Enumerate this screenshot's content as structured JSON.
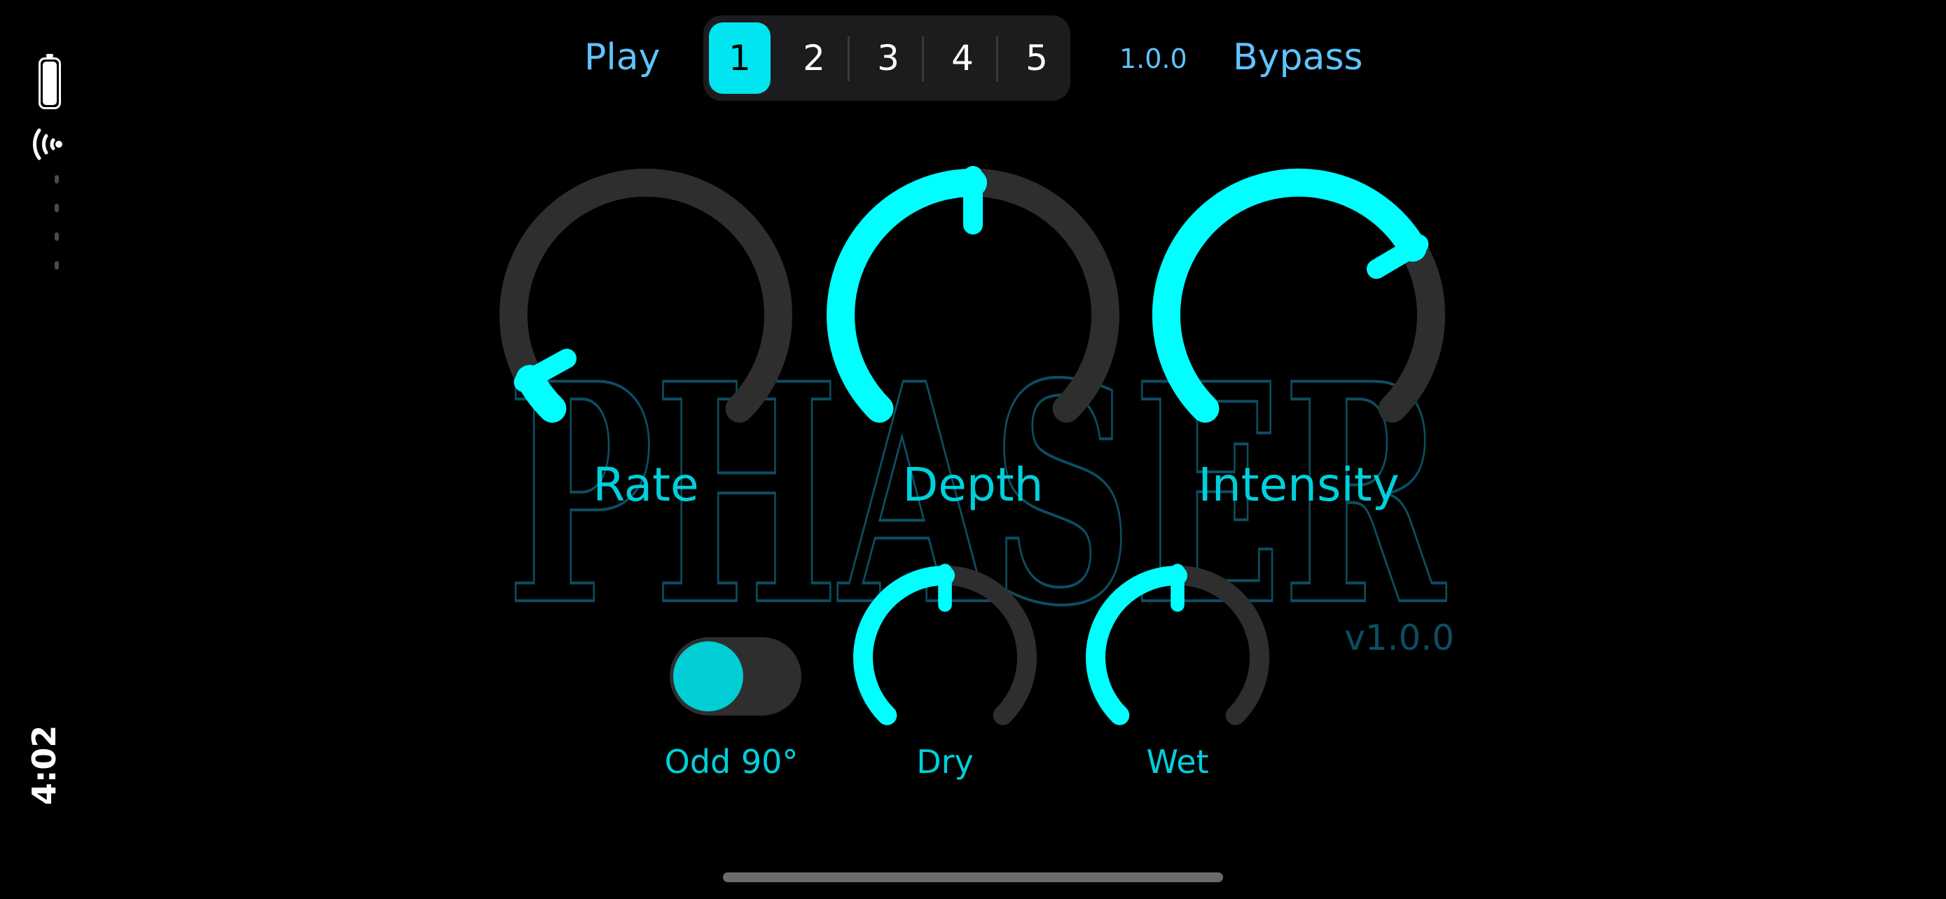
{
  "status_bar": {
    "time": "4:02"
  },
  "toolbar": {
    "play_label": "Play",
    "presets": [
      "1",
      "2",
      "3",
      "4",
      "5"
    ],
    "active_preset": "1",
    "version": "1.0.0",
    "bypass_label": "Bypass"
  },
  "branding": {
    "watermark": "PHASER",
    "version": "v1.0.0"
  },
  "colors": {
    "accent": "#00ffff",
    "track": "#2e2e2e",
    "label": "#00d0dc",
    "toolbar_text": "#5ec4ff",
    "background": "#000000"
  },
  "knobs": [
    {
      "id": "rate",
      "label": "Rate",
      "value": 0.06
    },
    {
      "id": "depth",
      "label": "Depth",
      "value": 0.5
    },
    {
      "id": "intensity",
      "label": "Intensity",
      "value": 0.72
    },
    {
      "id": "dry",
      "label": "Dry",
      "value": 0.5
    },
    {
      "id": "wet",
      "label": "Wet",
      "value": 0.5
    }
  ],
  "toggle": {
    "label": "Odd 90°",
    "on": false
  }
}
